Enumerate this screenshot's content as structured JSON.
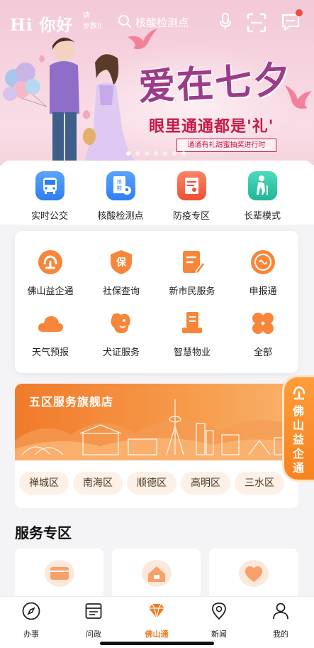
{
  "header": {
    "greeting": "Hi 你好",
    "greeting_small": "请",
    "steps": "步数0",
    "search_placeholder": "核酸检测点"
  },
  "banner": {
    "title": "爱在七夕",
    "subtitle": "眼里通通都是'礼'",
    "pill": "通通有礼甜蜜抽奖进行时",
    "dot_count": 7,
    "active_dot": 0
  },
  "quick_row": [
    {
      "label": "实时公交",
      "icon": "bus-icon",
      "color": "#3f8ef7"
    },
    {
      "label": "核酸检测点",
      "icon": "test-site-icon",
      "color": "#3f8ef7"
    },
    {
      "label": "防疫专区",
      "icon": "epidemic-icon",
      "color": "#f2603d"
    },
    {
      "label": "长辈模式",
      "icon": "elder-icon",
      "color": "#27c3a7"
    }
  ],
  "services": [
    {
      "label": "佛山益企通",
      "icon": "enterprise-icon"
    },
    {
      "label": "社保查询",
      "icon": "social-security-icon"
    },
    {
      "label": "新市民服务",
      "icon": "new-resident-icon"
    },
    {
      "label": "申报通",
      "icon": "declare-icon"
    },
    {
      "label": "天气预报",
      "icon": "weather-icon"
    },
    {
      "label": "犬证服务",
      "icon": "dog-license-icon"
    },
    {
      "label": "智慧物业",
      "icon": "property-icon"
    },
    {
      "label": "全部",
      "icon": "all-icon"
    }
  ],
  "districts": {
    "title": "五区服务旗舰店",
    "items": [
      "禅城区",
      "南海区",
      "顺德区",
      "高明区",
      "三水区"
    ]
  },
  "float_button": {
    "label": "佛山益企通"
  },
  "section": {
    "title": "服务专区"
  },
  "tabs": [
    {
      "label": "办事",
      "icon": "compass-icon"
    },
    {
      "label": "问政",
      "icon": "news-list-icon"
    },
    {
      "label": "佛山通",
      "icon": "diamond-icon",
      "active": true
    },
    {
      "label": "新闻",
      "icon": "location-icon"
    },
    {
      "label": "我的",
      "icon": "person-icon"
    }
  ],
  "colors": {
    "accent": "#f07b1f",
    "banner_title": "#9b3c8a",
    "banner_sub": "#c41b48"
  }
}
